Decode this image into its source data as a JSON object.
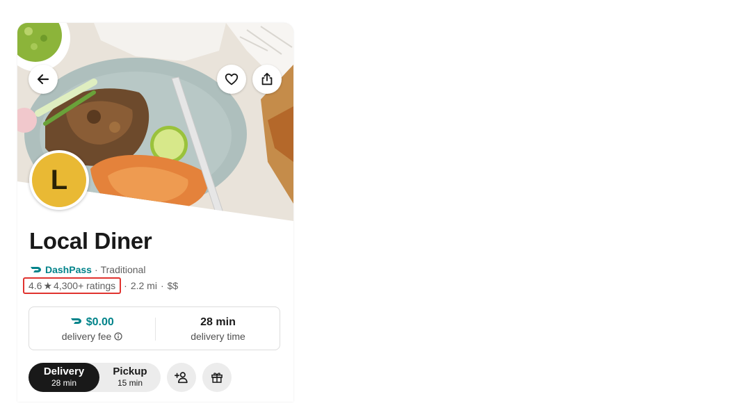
{
  "store": {
    "name": "Local Diner",
    "avatar_letter": "L",
    "dashpass_label": "DashPass",
    "category_sep": "·",
    "category": "Traditional",
    "rating": "4.6",
    "ratings_count": "4,300+ ratings",
    "distance": "2.2 mi",
    "price": "$$",
    "separator": "·"
  },
  "info": {
    "delivery_fee": "$0.00",
    "delivery_fee_label": "delivery fee",
    "delivery_time": "28 min",
    "delivery_time_label": "delivery time"
  },
  "mode": {
    "delivery_label": "Delivery",
    "delivery_time": "28 min",
    "pickup_label": "Pickup",
    "pickup_time": "15 min"
  },
  "colors": {
    "dashpass_teal": "#00838A",
    "avatar_yellow": "#E9B934",
    "highlight_red": "#E0332F",
    "active_segment": "#191919"
  },
  "icons": [
    "back-arrow-icon",
    "heart-icon",
    "share-icon",
    "info-icon",
    "dashpass-icon",
    "star-icon",
    "group-order-icon",
    "gift-icon"
  ]
}
